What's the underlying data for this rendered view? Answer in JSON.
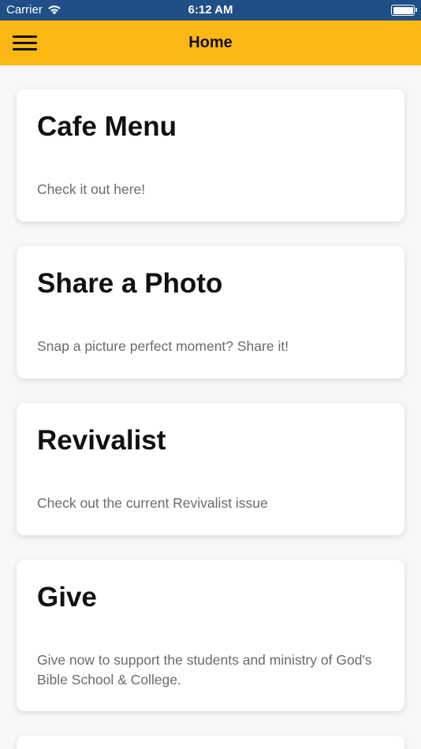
{
  "status_bar": {
    "carrier": "Carrier",
    "time": "6:12 AM",
    "wifi_icon": "wifi-icon",
    "battery_icon": "battery-icon",
    "background_color": "#1f4f86"
  },
  "nav_bar": {
    "title": "Home",
    "menu_icon": "hamburger-menu-icon",
    "background_color": "#fbb714"
  },
  "cards": [
    {
      "title": "Cafe Menu",
      "description": "Check it out here!"
    },
    {
      "title": "Share a Photo",
      "description": "Snap a picture perfect moment? Share it!"
    },
    {
      "title": "Revivalist",
      "description": "Check out the current Revivalist issue"
    },
    {
      "title": "Give",
      "description": "Give now to support the students and ministry of God's Bible School & College."
    }
  ]
}
